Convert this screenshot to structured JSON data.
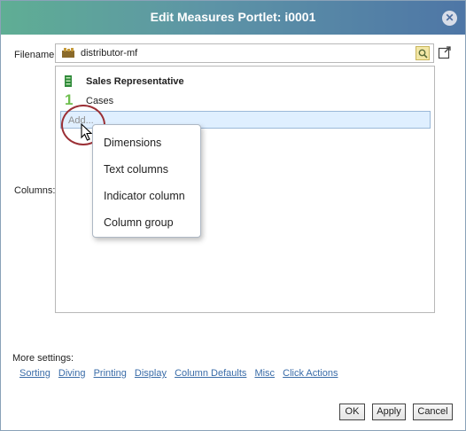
{
  "dialog": {
    "title": "Edit Measures Portlet: i0001",
    "close_icon": "close-icon"
  },
  "form": {
    "filename_label": "Filename:",
    "filename_value": "distributor-mf",
    "columns_label": "Columns:"
  },
  "columns": {
    "items": [
      {
        "label": "Sales Representative",
        "icon": "dimension-icon"
      },
      {
        "label": "Cases",
        "number": "1"
      }
    ],
    "add_placeholder": "Add..."
  },
  "add_menu": {
    "items": [
      "Dimensions",
      "Text columns",
      "Indicator column",
      "Column group"
    ]
  },
  "more_settings": {
    "label": "More settings:",
    "links": [
      "Sorting",
      "Diving",
      "Printing",
      "Display",
      "Column Defaults",
      "Misc",
      "Click Actions"
    ]
  },
  "buttons": {
    "ok": "OK",
    "apply": "Apply",
    "cancel": "Cancel"
  }
}
